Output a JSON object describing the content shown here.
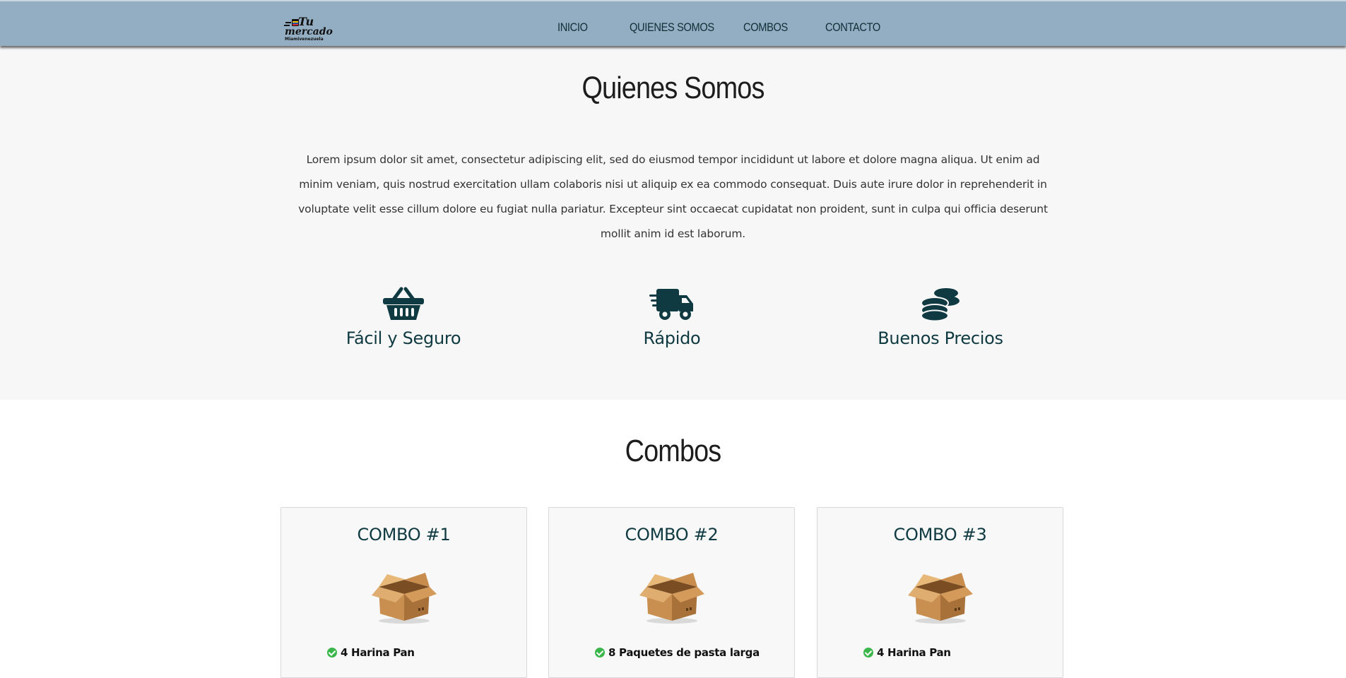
{
  "header": {
    "logo": {
      "line1": "Tu",
      "line2": "mercado",
      "line3": "Miamivenezuela"
    },
    "nav": [
      {
        "label": "INICIO"
      },
      {
        "label": "QUIENES SOMOS"
      },
      {
        "label": "COMBOS"
      },
      {
        "label": "CONTACTO"
      }
    ]
  },
  "about": {
    "title": "Quienes Somos",
    "text": "Lorem ipsum dolor sit amet, consectetur adipiscing elit, sed do eiusmod tempor incididunt ut labore et dolore magna aliqua. Ut enim ad minim veniam, quis nostrud exercitation ullam colaboris nisi ut aliquip ex ea commodo consequat. Duis aute irure dolor in reprehenderit in voluptate velit esse cillum dolore eu fugiat nulla pariatur. Excepteur sint occaecat cupidatat non proident, sunt in culpa qui officia deserunt mollit anim id est laborum.",
    "features": [
      {
        "icon": "basket-icon",
        "label": "Fácil y Seguro"
      },
      {
        "icon": "truck-icon",
        "label": "Rápido"
      },
      {
        "icon": "coins-icon",
        "label": "Buenos Precios"
      }
    ]
  },
  "combos": {
    "title": "Combos",
    "cards": [
      {
        "title": "COMBO #1",
        "icon": "box-icon",
        "first_item": "4 Harina Pan"
      },
      {
        "title": "COMBO #2",
        "icon": "box-icon",
        "first_item": "8 Paquetes de pasta larga"
      },
      {
        "title": "COMBO #3",
        "icon": "box-icon",
        "first_item": "4 Harina Pan"
      }
    ]
  },
  "colors": {
    "header_bg": "#93aec2",
    "accent_dark": "#0f3a41",
    "section_gray": "#f7f7f7",
    "check_green": "#3bb64a"
  }
}
